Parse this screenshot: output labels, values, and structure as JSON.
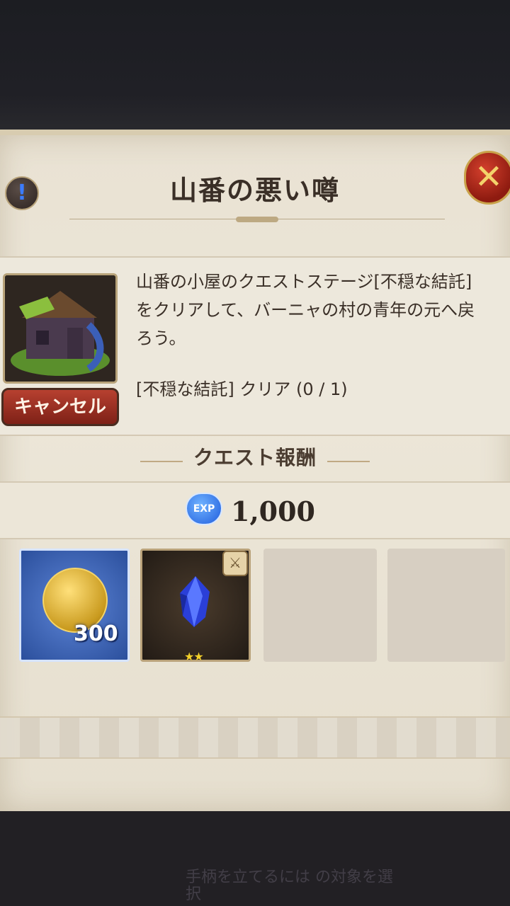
{
  "dialog": {
    "title": "山番の悪い噂",
    "info_icon": "info-icon",
    "close_icon": "close-x-icon"
  },
  "quest": {
    "description": "山番の小屋のクエストステージ[不穏な結託]\nをクリアして、バーニャの村の青年の元へ戻\nろう。",
    "objective": "[不穏な結託] クリア (0 / 1)",
    "cancel_label": "キャンセル"
  },
  "rewards": {
    "heading": "クエスト報酬",
    "exp_icon_label": "EXP",
    "exp_value": "1,000",
    "items": [
      {
        "icon": "gold-coin-icon",
        "count": "300"
      },
      {
        "icon": "blue-crystal-icon",
        "stars": "★★",
        "badge_icon": "equipment-badge-icon"
      },
      {
        "icon": "empty-slot"
      },
      {
        "icon": "empty-slot"
      }
    ]
  },
  "background_hint": "手柄を立てるには\nの対象を選択"
}
